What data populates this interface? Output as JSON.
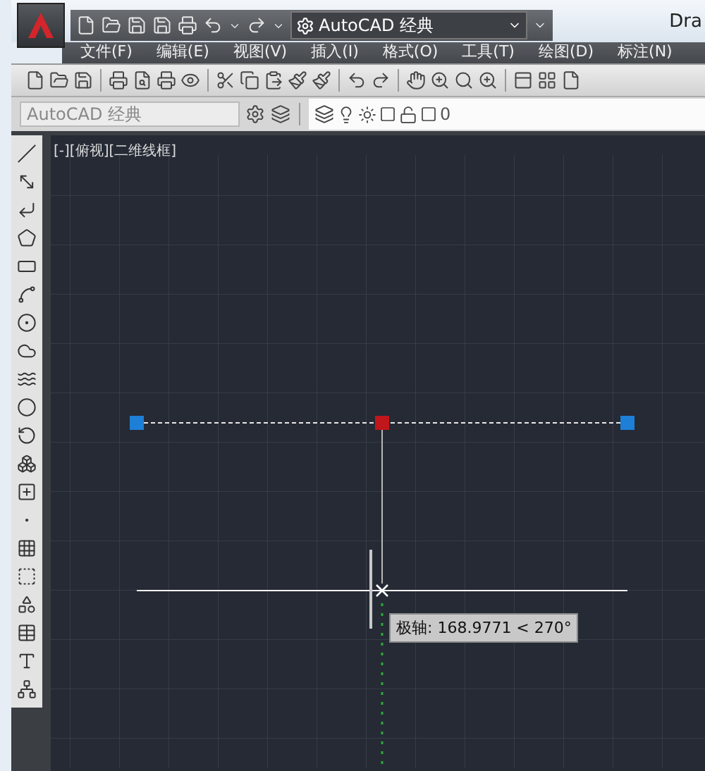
{
  "title_bar": {
    "workspace": "AutoCAD 经典",
    "title": "Dra"
  },
  "menu": [
    "文件(F)",
    "编辑(E)",
    "视图(V)",
    "插入(I)",
    "格式(O)",
    "工具(T)",
    "绘图(D)",
    "标注(N)"
  ],
  "styles_toolbar": {
    "workspace": "AutoCAD 经典",
    "layer": "0"
  },
  "viewport": {
    "label": "[-][俯视][二维线框]",
    "tooltip": "极轴: 168.9771 < 270°"
  }
}
